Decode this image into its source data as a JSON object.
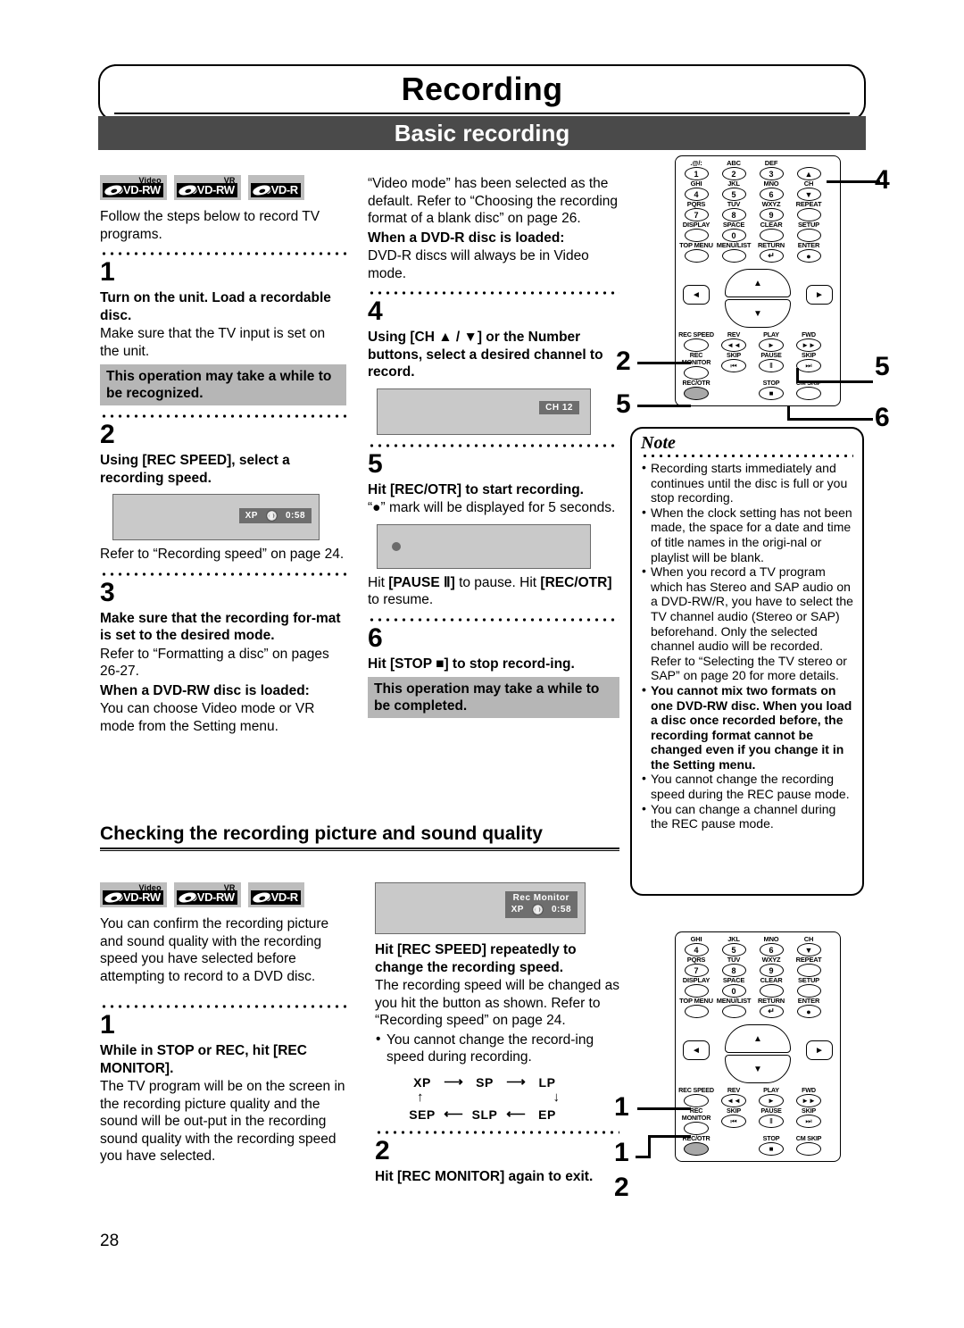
{
  "header": {
    "chapter": "Recording",
    "section": "Basic recording"
  },
  "page_number": "28",
  "disc_logos": [
    {
      "top": "Video",
      "main": "DVD-RW"
    },
    {
      "top": "VR",
      "main": "DVD-RW"
    },
    {
      "top": "",
      "main": "DVD-R"
    }
  ],
  "left_column": {
    "intro": "Follow the steps below to record TV programs.",
    "step1": {
      "num": "1",
      "title": "Turn on the unit. Load a recordable disc.",
      "body": "Make sure that the TV input is set on the unit.",
      "callout": "This operation may take a while to be recognized."
    },
    "step2": {
      "num": "2",
      "title": "Using [REC SPEED], select a recording speed.",
      "osd": {
        "speed": "XP",
        "time": "0:58"
      },
      "body": "Refer to “Recording speed” on page 24."
    },
    "step3": {
      "num": "3",
      "title": "Make sure that the recording for-mat is set to the desired mode.",
      "body1": "Refer to “Formatting a disc” on pages 26-27.",
      "subtitle": "When a DVD-RW disc is loaded:",
      "body2": "You can choose Video mode or VR mode from the Setting menu."
    }
  },
  "mid_column": {
    "intro": "“Video mode” has been selected as the default. Refer to “Choosing the recording format of a blank disc” on page 26.",
    "intro_bold": "When a DVD-R disc is loaded:",
    "intro_after": "DVD-R discs will always be in Video mode.",
    "step4": {
      "num": "4",
      "title": "Using [CH ▲ / ▼] or the Number buttons, select a desired channel to record.",
      "osd": {
        "channel": "CH 12"
      }
    },
    "step5": {
      "num": "5",
      "title": "Hit [REC/OTR] to start recording.",
      "body": "“●” mark will be displayed for 5 seconds.",
      "after_bold_1": "Hit ",
      "after_bold_2": "[PAUSE Ⅱ]",
      "after_3": " to pause. Hit ",
      "after_bold_4": "[REC/OTR]",
      "after_5": " to resume."
    },
    "step6": {
      "num": "6",
      "title": "Hit [STOP ■] to stop record-ing.",
      "callout": "This operation may take a while to be completed."
    }
  },
  "subsection": {
    "heading": "Checking the recording picture and sound quality",
    "left_body": "You can confirm the recording picture and sound quality with the recording speed you have selected before attempting to record to a DVD disc.",
    "osd": {
      "title": "Rec Monitor",
      "speed": "XP",
      "time": "0:58"
    },
    "right_title": "Hit [REC SPEED] repeatedly to change the recording speed.",
    "right_body": "The recording speed will be changed as you hit the button as shown. Refer to “Recording speed” on page 24.",
    "right_bullet": "You cannot change the record-ing speed during recording.",
    "speed_flow": {
      "top": [
        "XP",
        "SP",
        "LP"
      ],
      "bottom": [
        "SEP",
        "SLP",
        "EP"
      ]
    },
    "step1": {
      "num": "1",
      "title": "While in STOP or REC, hit [REC MONITOR].",
      "body": "The TV program will be on the screen in the recording picture quality and the sound will be out-put in the recording sound quality with the recording speed you have selected."
    },
    "step2": {
      "num": "2",
      "title": "Hit [REC MONITOR] again to exit."
    }
  },
  "note": {
    "title": "Note",
    "items": [
      {
        "text": "Recording starts immediately and continues until the disc is full or you stop recording.",
        "bold": false
      },
      {
        "text": "When the clock setting has not been made, the space for a date and time of title names in the origi-nal or playlist will be blank.",
        "bold": false
      },
      {
        "text": "When you record a TV program which has Stereo and SAP audio on a DVD-RW/R, you have to select the TV channel audio (Stereo or SAP) beforehand. Only the selected channel audio will be recorded. Refer to “Selecting the TV stereo or SAP” on page 20 for more details.",
        "bold": false
      },
      {
        "text": "You cannot mix two formats on one DVD-RW disc. When you load a disc once recorded before, the recording format cannot be changed even if you change it in the Setting menu.",
        "bold": true
      },
      {
        "text": "You cannot change the recording speed during the REC pause mode.",
        "bold": false
      },
      {
        "text": "You can change a channel during the REC pause mode.",
        "bold": false
      }
    ]
  },
  "remote_top": {
    "callouts": [
      "4",
      "2",
      "5",
      "5",
      "6"
    ],
    "keypad_rows": [
      [
        {
          "label": ".@/:",
          "key": "1"
        },
        {
          "label": "ABC",
          "key": "2"
        },
        {
          "label": "DEF",
          "key": "3"
        },
        {
          "label": "",
          "key": "▲"
        }
      ],
      [
        {
          "label": "GHI",
          "key": "4"
        },
        {
          "label": "JKL",
          "key": "5"
        },
        {
          "label": "MNO",
          "key": "6"
        },
        {
          "label": "CH",
          "key": "▼"
        }
      ],
      [
        {
          "label": "PQRS",
          "key": "7"
        },
        {
          "label": "TUV",
          "key": "8"
        },
        {
          "label": "WXYZ",
          "key": "9"
        },
        {
          "label": "REPEAT",
          "key": ""
        }
      ],
      [
        {
          "label": "DISPLAY",
          "key": ""
        },
        {
          "label": "SPACE",
          "key": "0"
        },
        {
          "label": "CLEAR",
          "key": ""
        },
        {
          "label": "SETUP",
          "key": ""
        }
      ],
      [
        {
          "label": "TOP MENU",
          "key": ""
        },
        {
          "label": "MENU/LIST",
          "key": ""
        },
        {
          "label": "RETURN",
          "key": "↵"
        },
        {
          "label": "ENTER",
          "key": "●"
        }
      ]
    ],
    "transport_rows": [
      [
        {
          "label": "REC SPEED",
          "key": ""
        },
        {
          "label": "REV",
          "key": "◄◄"
        },
        {
          "label": "PLAY",
          "key": "►"
        },
        {
          "label": "FWD",
          "key": "►►"
        }
      ],
      [
        {
          "label": "REC MONITOR",
          "key": ""
        },
        {
          "label": "SKIP",
          "key": "⏮"
        },
        {
          "label": "PAUSE",
          "key": "Ⅱ"
        },
        {
          "label": "SKIP",
          "key": "⏭"
        }
      ],
      [
        {
          "label": "REC/OTR",
          "key": ""
        },
        {
          "label": "",
          "key": ""
        },
        {
          "label": "STOP",
          "key": "■"
        },
        {
          "label": "CM SKIP",
          "key": ""
        }
      ]
    ]
  },
  "remote_bottom": {
    "callouts": [
      "1",
      "1",
      "2"
    ],
    "keypad_rows": [
      [
        {
          "label": "GHI",
          "key": "4"
        },
        {
          "label": "JKL",
          "key": "5"
        },
        {
          "label": "MNO",
          "key": "6"
        },
        {
          "label": "CH",
          "key": "▼"
        }
      ],
      [
        {
          "label": "PQRS",
          "key": "7"
        },
        {
          "label": "TUV",
          "key": "8"
        },
        {
          "label": "WXYZ",
          "key": "9"
        },
        {
          "label": "REPEAT",
          "key": ""
        }
      ],
      [
        {
          "label": "DISPLAY",
          "key": ""
        },
        {
          "label": "SPACE",
          "key": "0"
        },
        {
          "label": "CLEAR",
          "key": ""
        },
        {
          "label": "SETUP",
          "key": ""
        }
      ],
      [
        {
          "label": "TOP MENU",
          "key": ""
        },
        {
          "label": "MENU/LIST",
          "key": ""
        },
        {
          "label": "RETURN",
          "key": "↵"
        },
        {
          "label": "ENTER",
          "key": "●"
        }
      ]
    ],
    "transport_rows": [
      [
        {
          "label": "REC SPEED",
          "key": ""
        },
        {
          "label": "REV",
          "key": "◄◄"
        },
        {
          "label": "PLAY",
          "key": "►"
        },
        {
          "label": "FWD",
          "key": "►►"
        }
      ],
      [
        {
          "label": "REC MONITOR",
          "key": ""
        },
        {
          "label": "SKIP",
          "key": "⏮"
        },
        {
          "label": "PAUSE",
          "key": "Ⅱ"
        },
        {
          "label": "SKIP",
          "key": "⏭"
        }
      ],
      [
        {
          "label": "REC/OTR",
          "key": ""
        },
        {
          "label": "",
          "key": ""
        },
        {
          "label": "STOP",
          "key": "■"
        },
        {
          "label": "CM SKIP",
          "key": ""
        }
      ]
    ]
  }
}
